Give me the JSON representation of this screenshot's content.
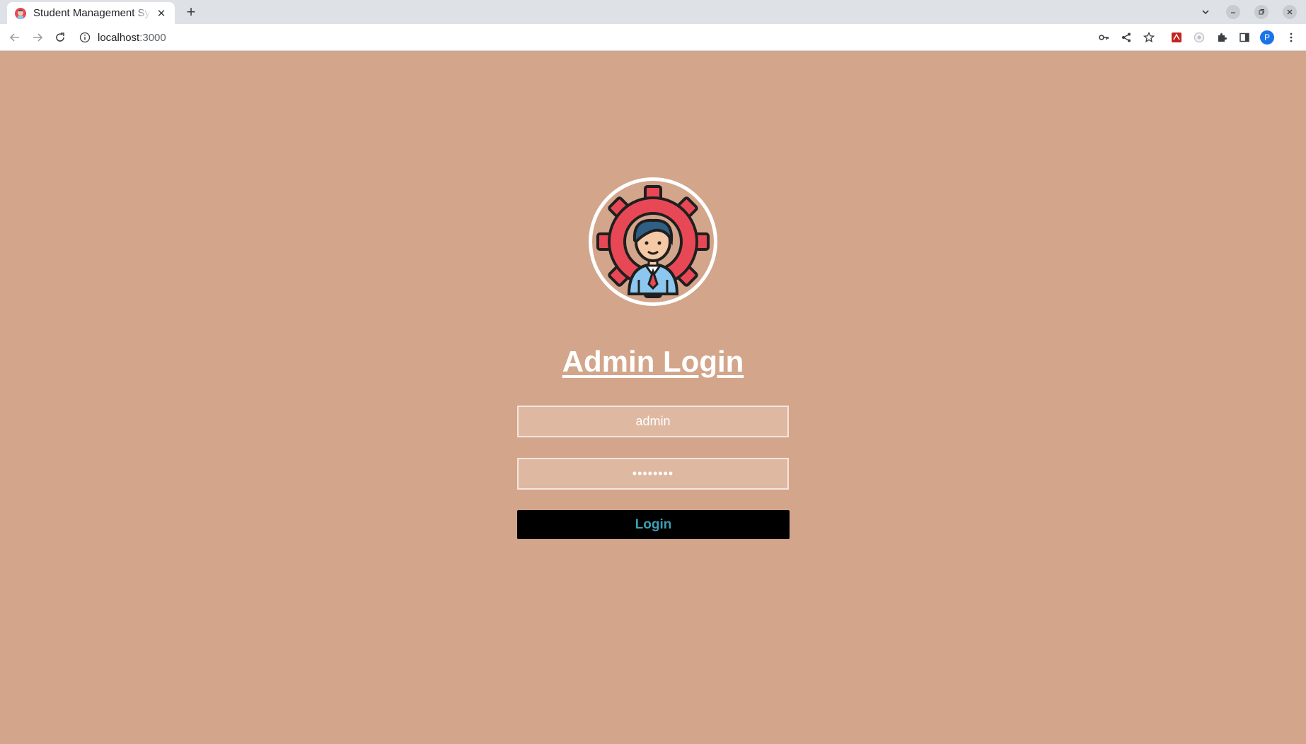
{
  "browser": {
    "tab_title": "Student Management System",
    "tab_close": "✕",
    "new_tab": "+",
    "url_host": "localhost",
    "url_port": ":3000",
    "profile_initial": "P"
  },
  "page": {
    "title": "Admin Login",
    "username_value": "admin",
    "password_value": "••••••••",
    "login_label": "Login"
  },
  "colors": {
    "background": "#d3a58a",
    "input_bg": "#dfb8a2",
    "button_bg": "#000000",
    "button_text": "#3aa0b6",
    "logo_gear": "#e84855"
  }
}
